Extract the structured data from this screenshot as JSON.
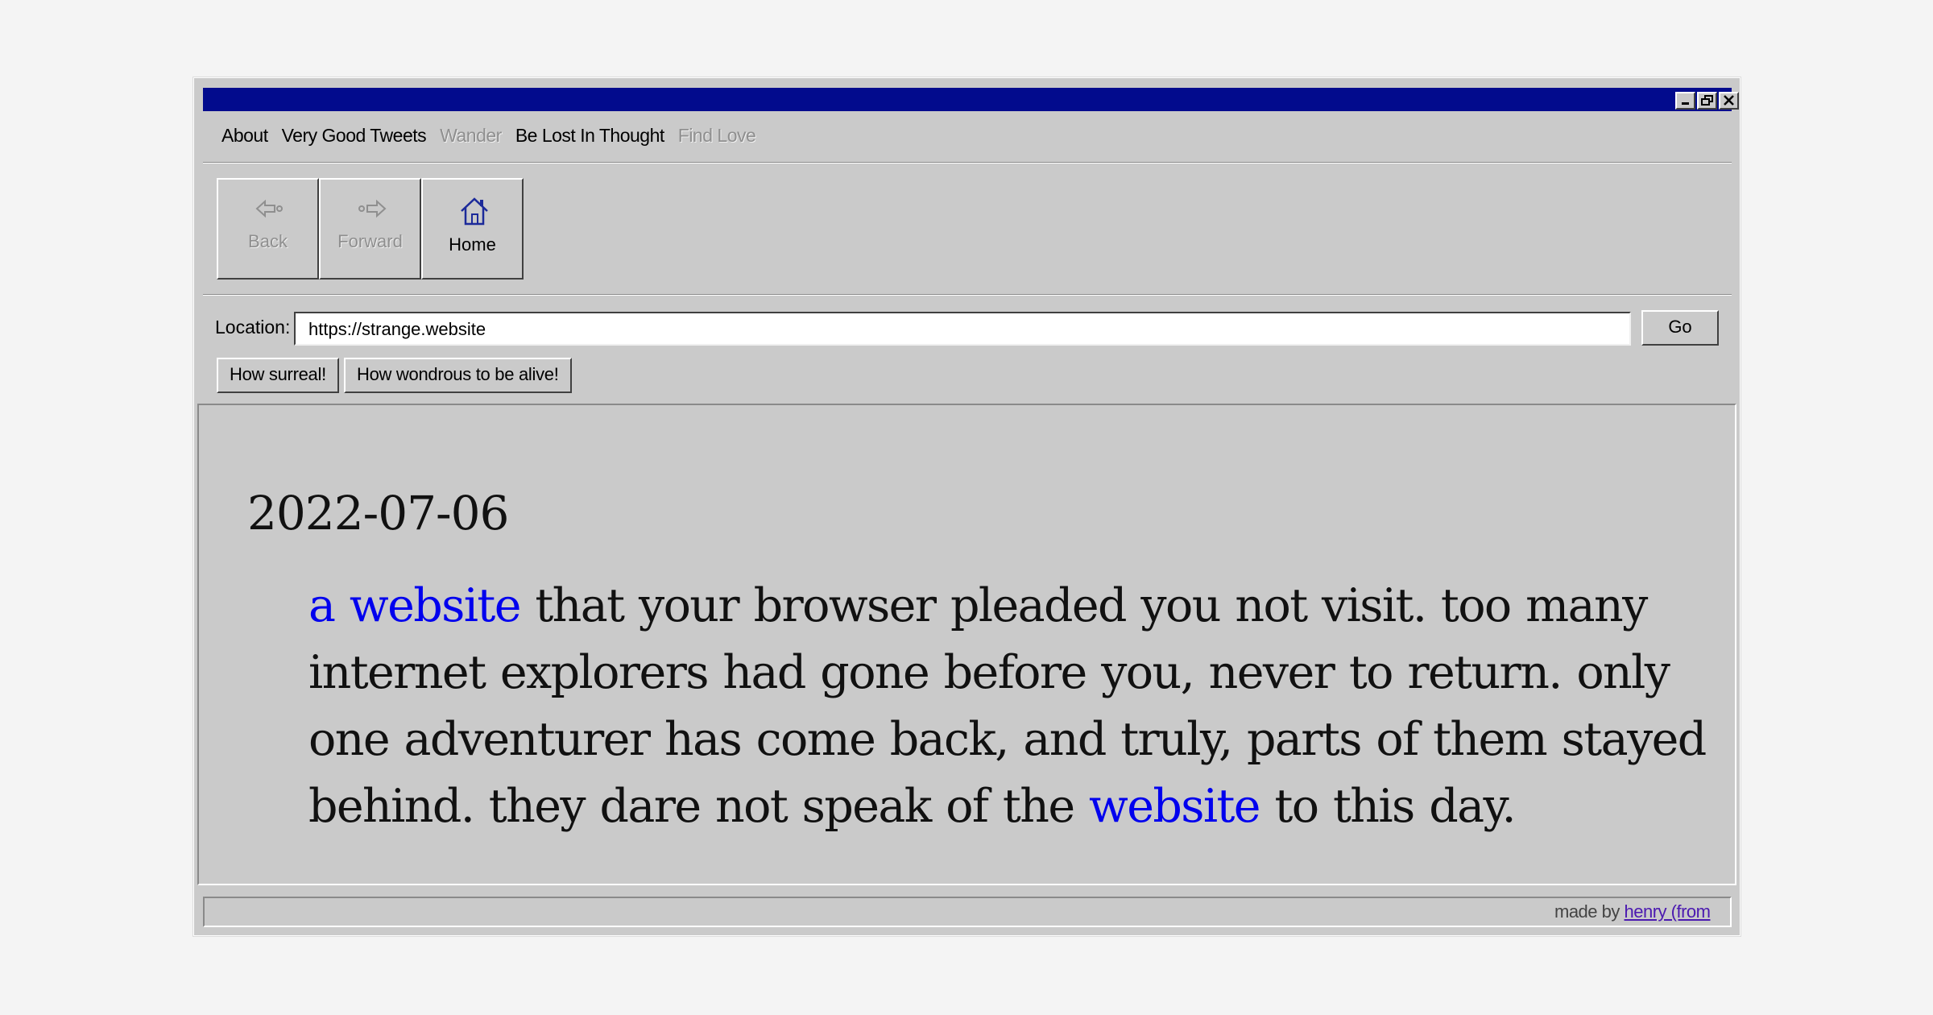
{
  "menu": {
    "items": [
      {
        "label": "About",
        "disabled": false
      },
      {
        "label": "Very Good Tweets",
        "disabled": false
      },
      {
        "label": "Wander",
        "disabled": true
      },
      {
        "label": "Be Lost In Thought",
        "disabled": false
      },
      {
        "label": "Find Love",
        "disabled": true
      }
    ]
  },
  "toolbar": {
    "back_label": "Back",
    "forward_label": "Forward",
    "home_label": "Home"
  },
  "location": {
    "label": "Location:",
    "value": "https://strange.website",
    "go_label": "Go"
  },
  "quick_buttons": [
    "How surreal!",
    "How wondrous to be alive!"
  ],
  "content": {
    "date": "2022-07-06",
    "link1": "a website",
    "text1": " that your browser pleaded you not visit. too many internet explorers had gone before you, never to return. only one adventurer has come back, and truly, parts of them stayed behind. they dare not speak of the ",
    "link2": "website",
    "text2": " to this day."
  },
  "status": {
    "made_by": "made by ",
    "author_link": "henry (from"
  },
  "colors": {
    "titlebar": "#020b8d",
    "window_bg": "#cacaca",
    "link": "#0000ee"
  }
}
